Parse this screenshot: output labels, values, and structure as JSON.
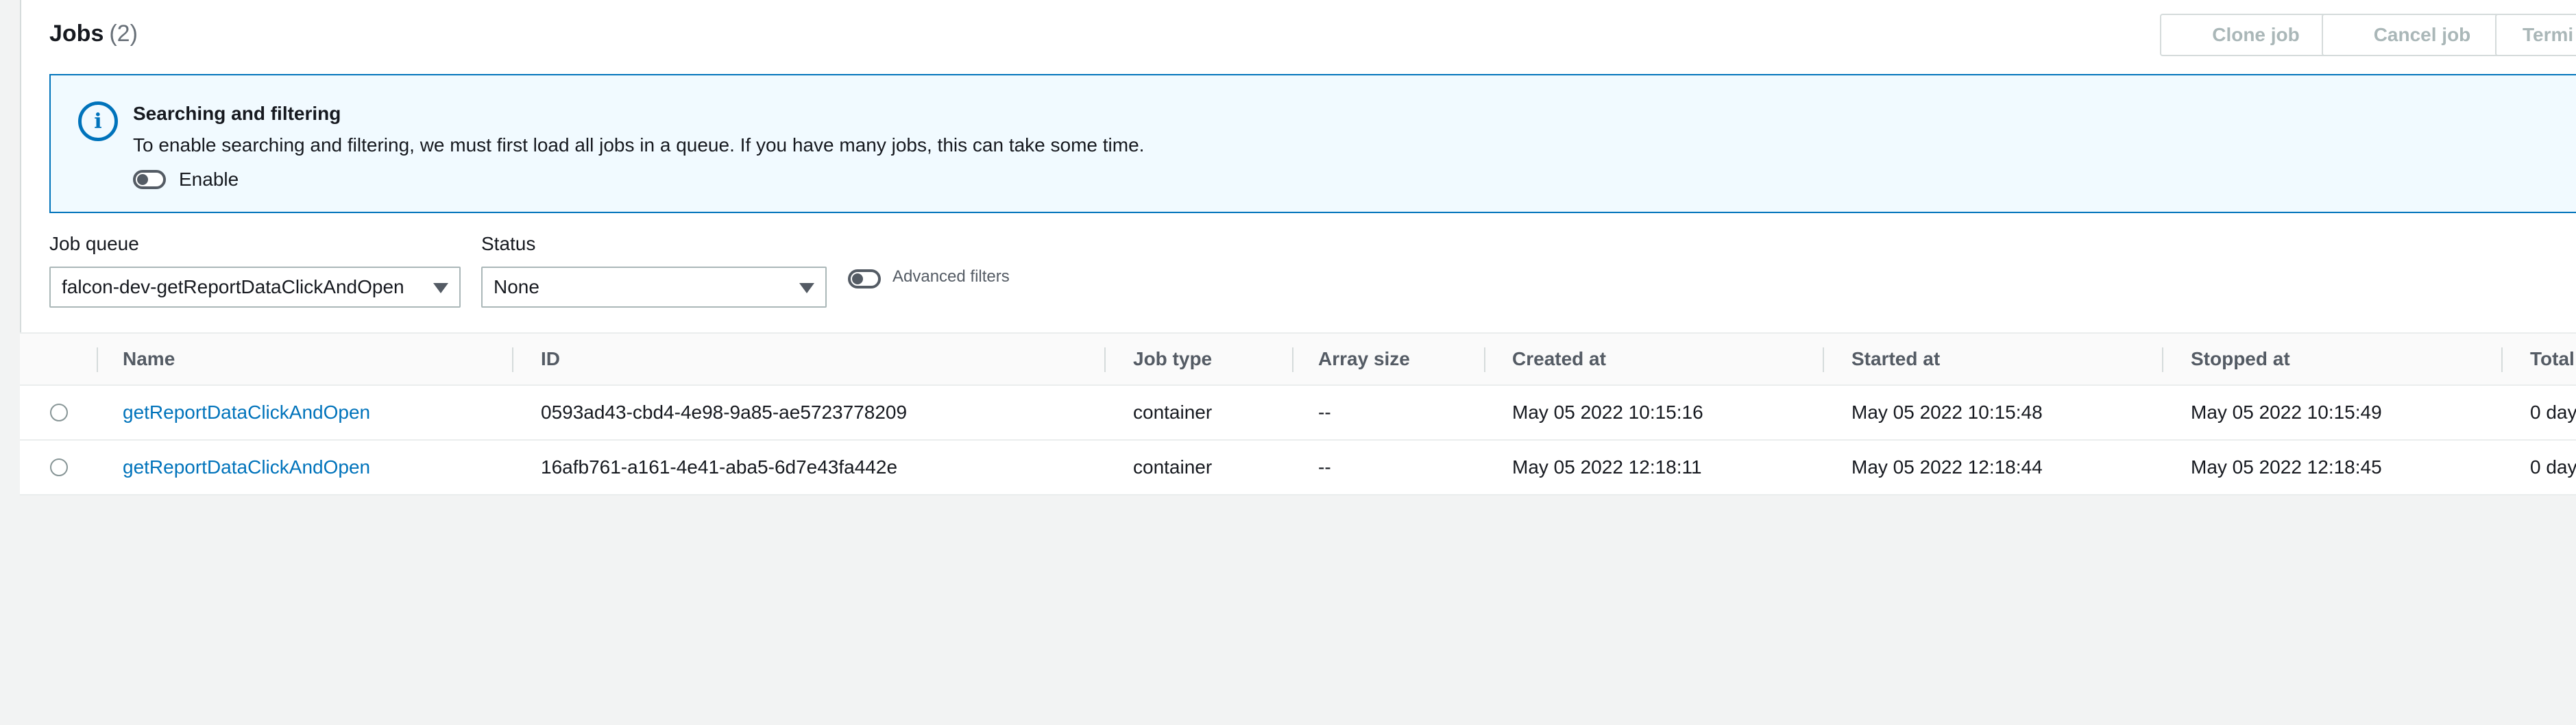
{
  "header": {
    "title": "Jobs",
    "count": "(2)",
    "buttons": {
      "clone": "Clone job",
      "cancel": "Cancel job",
      "terminate": "Termi"
    }
  },
  "info": {
    "icon": "info-icon",
    "title": "Searching and filtering",
    "text": "To enable searching and filtering, we must first load all jobs in a queue. If you have many jobs, this can take some time.",
    "toggle_label": "Enable",
    "toggle_on": false
  },
  "filters": {
    "job_queue": {
      "label": "Job queue",
      "value": "falcon-dev-getReportDataClickAndOpen"
    },
    "status": {
      "label": "Status",
      "value": "None"
    },
    "advanced": {
      "label": "Advanced filters",
      "on": false
    }
  },
  "table": {
    "columns": [
      "Name",
      "ID",
      "Job type",
      "Array size",
      "Created at",
      "Started at",
      "Stopped at",
      "Total"
    ],
    "rows": [
      {
        "name": "getReportDataClickAndOpen",
        "id": "0593ad43-cbd4-4e98-9a85-ae5723778209",
        "job_type": "container",
        "array_size": "--",
        "created_at": "May 05 2022 10:15:16",
        "started_at": "May 05 2022 10:15:48",
        "stopped_at": "May 05 2022 10:15:49",
        "total": "0 day"
      },
      {
        "name": "getReportDataClickAndOpen",
        "id": "16afb761-a161-4e41-aba5-6d7e43fa442e",
        "job_type": "container",
        "array_size": "--",
        "created_at": "May 05 2022 12:18:11",
        "started_at": "May 05 2022 12:18:44",
        "stopped_at": "May 05 2022 12:18:45",
        "total": "0 day"
      }
    ]
  }
}
